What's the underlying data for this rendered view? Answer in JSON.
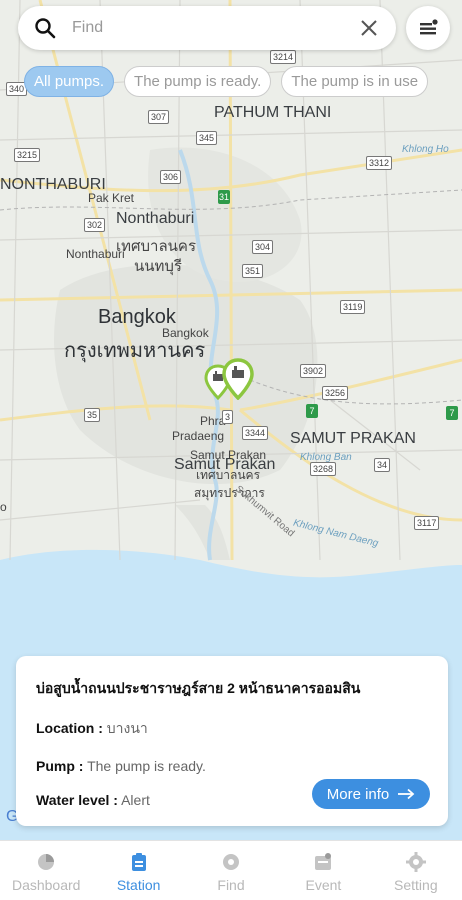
{
  "search": {
    "placeholder": "Find"
  },
  "filters": [
    {
      "label": "All pumps.",
      "active": true
    },
    {
      "label": "The pump is ready.",
      "active": false
    },
    {
      "label": "The pump is in use",
      "active": false
    }
  ],
  "map": {
    "labels": {
      "pathum_thani": "PATHUM THANI",
      "nonthaburi_prov": "NONTHABURI",
      "pak_kret": "Pak Kret",
      "nonthaburi_city": "Nonthaburi",
      "nonthaburi_th": "เทศบาลนคร",
      "nonthaburi_th2": "นนทบุรี",
      "nonthaburi_small": "Nonthaburi",
      "bangkok": "Bangkok",
      "bangkok_small": "Bangkok",
      "bangkok_th": "กรุงเทพมหานคร",
      "phra_pradaeng_1": "Phra",
      "phra_pradaeng_2": "Pradaeng",
      "samut_prakan_prov": "SAMUT PRAKAN",
      "samut_prakan_city": "Samut Prakan",
      "samut_prakan_city2": "Samut Prakan",
      "samut_prakan_th": "เทศบาลนคร",
      "samut_prakan_th2": "สมุทรปราการ",
      "khlong_nam_daeng": "Khlong Nam Daeng",
      "sukhumvit_road": "Sukhumvit Road",
      "khlong_ho": "Khlong Ho",
      "khlong_bang": "Khlong Ban",
      "edge_o": "o"
    },
    "route_shields": [
      "3214",
      "340",
      "307",
      "345",
      "3215",
      "306",
      "302",
      "304",
      "3312",
      "351",
      "3119",
      "3902",
      "3256",
      "35",
      "3",
      "3344",
      "3268",
      "34",
      "3117"
    ],
    "green_shields": [
      "31",
      "7",
      "7"
    ],
    "attribution": "Goog"
  },
  "station": {
    "name": "บ่อสูบน้ำถนนประชาราษฎร์สาย 2 หน้าธนาคารออมสิน",
    "location_label": "Location :",
    "location_value": "บางนา",
    "pump_label": "Pump :",
    "pump_value": "The pump is ready.",
    "water_level_label": "Water level :",
    "water_level_value": "Alert",
    "more_info_label": "More info"
  },
  "nav": [
    {
      "label": "Dashboard",
      "icon": "dashboard-icon",
      "active": false
    },
    {
      "label": "Station",
      "icon": "station-icon",
      "active": true
    },
    {
      "label": "Find",
      "icon": "find-icon",
      "active": false
    },
    {
      "label": "Event",
      "icon": "event-icon",
      "active": false
    },
    {
      "label": "Setting",
      "icon": "setting-icon",
      "active": false
    }
  ],
  "colors": {
    "accent": "#3d8fe0",
    "chip_active": "#9dc9f0",
    "pin": "#8cc63f",
    "sea": "#c8e6f8"
  }
}
